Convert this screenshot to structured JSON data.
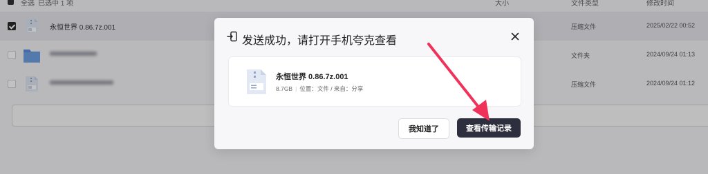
{
  "file_list": {
    "header": {
      "select_all": "全选",
      "selected_count": "已选中 1 项",
      "col_size": "大小",
      "col_type": "文件类型",
      "col_modified": "修改时间"
    },
    "rows": [
      {
        "name": "永恒世界 0.86.7z.001",
        "type": "压缩文件",
        "modified": "2025/02/22 00:52",
        "selected": true,
        "icon": "zip-file-icon"
      },
      {
        "name": "",
        "type": "文件夹",
        "modified": "2024/09/24 01:13",
        "selected": false,
        "icon": "folder-icon"
      },
      {
        "name": "",
        "type": "压缩文件",
        "modified": "2024/09/24 01:12",
        "selected": false,
        "icon": "zip-file-icon"
      }
    ]
  },
  "dialog": {
    "title": "发送成功，请打开手机夸克查看",
    "file": {
      "name": "永恒世界 0.86.7z.001",
      "size": "8.7GB",
      "location": "位置：文件 / 来自：分享"
    },
    "ok_label": "我知道了",
    "view_label": "查看传输记录"
  },
  "colors": {
    "primary_button": "#2d2f3e",
    "annotation_arrow": "#f0325a"
  }
}
